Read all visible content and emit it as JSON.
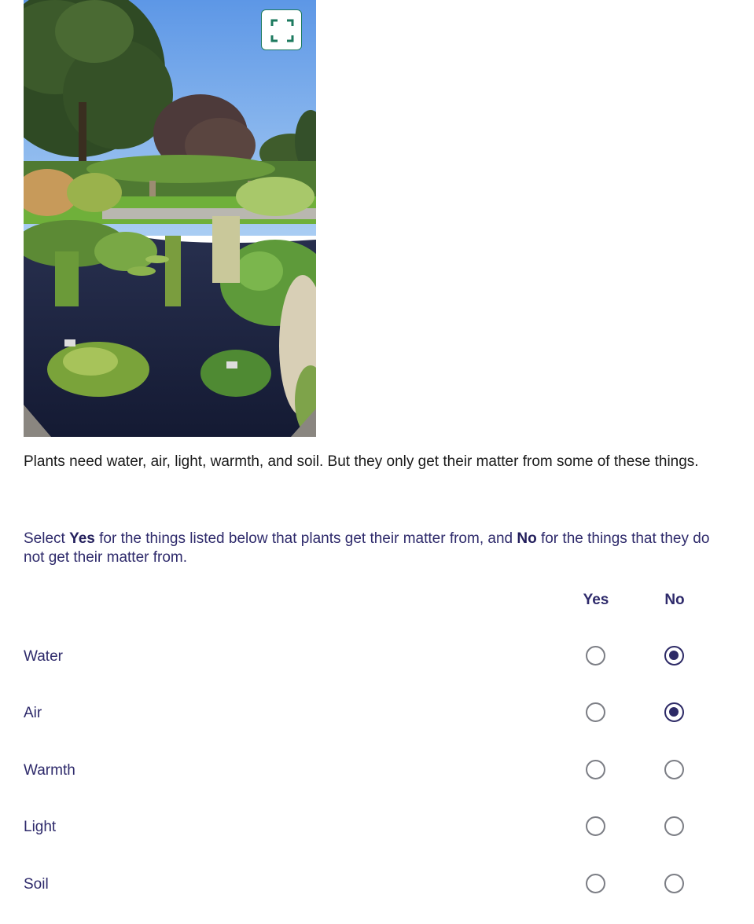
{
  "media": {
    "expand_icon": "expand-fullscreen-icon",
    "accent_color": "#1d7a5f"
  },
  "question": {
    "intro": "Plants need water, air, light, warmth, and soil. But they only get their matter from some of these things.",
    "instruction_parts": {
      "prefix": "Select ",
      "yes_word": "Yes",
      "middle": " for the things listed below that plants get their matter from, and ",
      "no_word": "No",
      "suffix": " for the things that they do not get their matter from."
    },
    "columns": {
      "yes": "Yes",
      "no": "No"
    },
    "rows": [
      {
        "label": "Water",
        "selected": "No"
      },
      {
        "label": "Air",
        "selected": "No"
      },
      {
        "label": "Warmth",
        "selected": ""
      },
      {
        "label": "Light",
        "selected": ""
      },
      {
        "label": "Soil",
        "selected": ""
      }
    ]
  },
  "colors": {
    "text_primary": "#2e2a6b",
    "radio_selected": "#2d2a66",
    "radio_unselected": "#7c7e85"
  }
}
